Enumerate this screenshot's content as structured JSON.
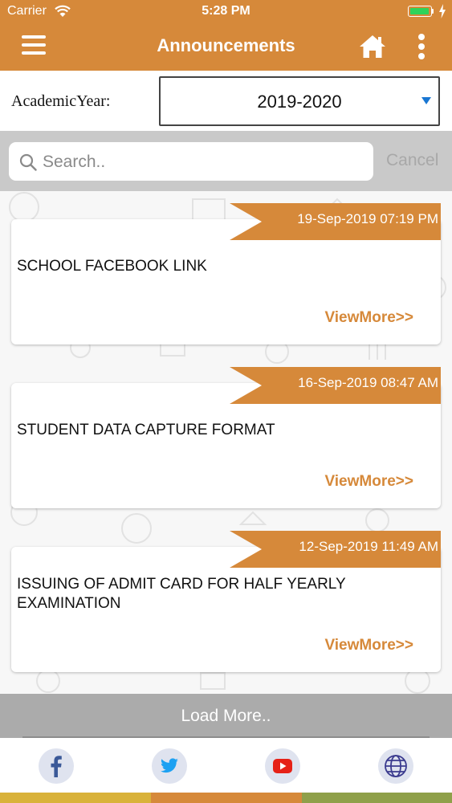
{
  "status": {
    "carrier": "Carrier",
    "time": "5:28 PM",
    "battery_level": 0.9
  },
  "header": {
    "title": "Announcements"
  },
  "academic": {
    "label": "AcademicYear:",
    "selected": "2019-2020"
  },
  "search": {
    "placeholder": "Search..",
    "cancel_label": "Cancel"
  },
  "announcements": [
    {
      "date": "19-Sep-2019 07:19 PM",
      "title": "SCHOOL FACEBOOK LINK",
      "view_more": "ViewMore>>"
    },
    {
      "date": "16-Sep-2019 08:47 AM",
      "title": "STUDENT DATA CAPTURE FORMAT",
      "view_more": "ViewMore>>"
    },
    {
      "date": "12-Sep-2019 11:49 AM",
      "title": "ISSUING OF ADMIT CARD FOR HALF YEARLY EXAMINATION",
      "view_more": "ViewMore>>"
    }
  ],
  "load_more": "Load More..",
  "footer": {
    "icons": [
      "facebook-icon",
      "twitter-icon",
      "youtube-icon",
      "globe-icon"
    ]
  },
  "colors": {
    "accent": "#d6893a",
    "stripe": [
      "#d9b23a",
      "#d6893a",
      "#8fa04a"
    ]
  }
}
